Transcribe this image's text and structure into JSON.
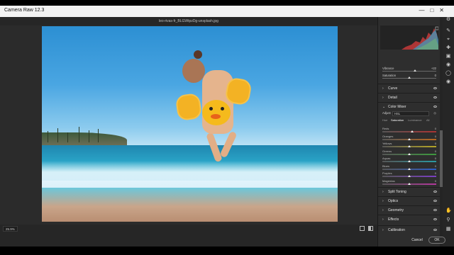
{
  "window": {
    "title": "Camera Raw 12.3"
  },
  "file": {
    "name": "leo-rivas-fr_BLGWtpzDg-unsplash.jpg"
  },
  "bottom": {
    "zoom": "25.9%"
  },
  "basic_tail": {
    "vibrance": {
      "label": "Vibrance",
      "value": "+22",
      "level": 0.61
    },
    "saturation": {
      "label": "Saturation",
      "value": "0",
      "level": 0.5
    }
  },
  "sections": {
    "curve": "Curve",
    "detail": "Detail",
    "color_mixer": "Color Mixer",
    "split_toning": "Split Toning",
    "optics": "Optics",
    "geometry": "Geometry",
    "effects": "Effects",
    "calibration": "Calibration"
  },
  "color_mixer": {
    "adjust_label": "Adjust",
    "adjust_value": "HSL",
    "tabs": [
      "Hue",
      "Saturation",
      "Luminance",
      "All"
    ],
    "active_tab": 1,
    "rows": [
      {
        "label": "Reds",
        "value": "0",
        "level": 0.55
      },
      {
        "label": "Oranges",
        "value": "0",
        "level": 0.5
      },
      {
        "label": "Yellows",
        "value": "0",
        "level": 0.5
      },
      {
        "label": "Greens",
        "value": "0",
        "level": 0.5
      },
      {
        "label": "Aquas",
        "value": "0",
        "level": 0.5
      },
      {
        "label": "Blues",
        "value": "0",
        "level": 0.5
      },
      {
        "label": "Purples",
        "value": "0",
        "level": 0.5
      },
      {
        "label": "Magentas",
        "value": "0",
        "level": 0.5
      }
    ],
    "track_colors": [
      "#a33",
      "#b8671f",
      "#b6a626",
      "#3e9a3e",
      "#2a9aa3",
      "#2e5ec9",
      "#7b3fc4",
      "#b3379c"
    ]
  },
  "footer": {
    "cancel": "Cancel",
    "ok": "OK"
  },
  "icons": [
    "gear-icon",
    "expand-icon",
    "edit-icon",
    "crop-icon",
    "healing-icon",
    "mask-icon",
    "redeye-icon",
    "presets-icon",
    "hand-icon",
    "zoom-icon",
    "grid-icon"
  ],
  "colors": {
    "panel": "#2e2e2e",
    "canvas": "#2b2b2b",
    "titlebar": "#f2f2f2"
  }
}
